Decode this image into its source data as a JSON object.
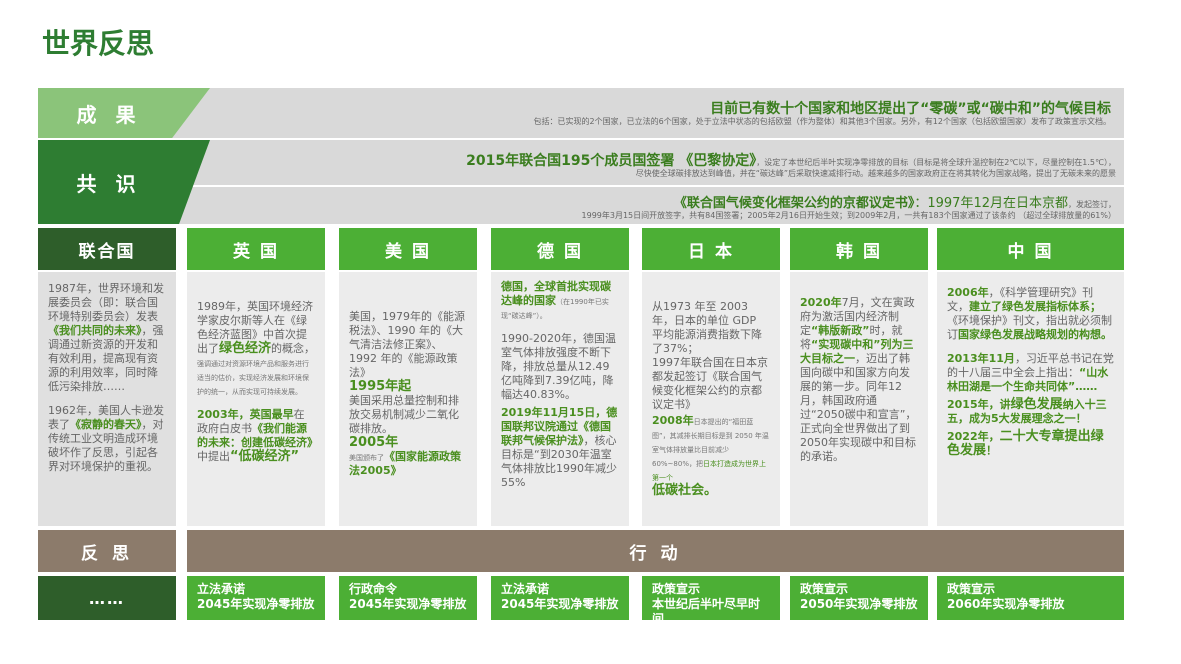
{
  "title": "世界反思",
  "rows": {
    "achievement": {
      "label": "成 果",
      "headline": "目前已有数十个国家和地区提出了“零碳”或“碳中和”的气候目标",
      "detail": "包括：已实现的2个国家，已立法的6个国家，处于立法中状态的包括欧盟（作为整体）和其他3个国家。另外，有12个国家（包括欧盟国家）发布了政策宣示文档。"
    },
    "consensus": {
      "label": "共 识",
      "paris_headline": "2015年联合国195个成员国签署 《巴黎协定》",
      "paris_detail_1": "，设定了本世纪后半叶实现净零排放的目标（目标是将全球升温控制在2℃以下，尽量控制在1.5℃），",
      "paris_detail_2": "尽快使全球碳排放达到峰值，并在“碳达峰”后采取快速减排行动。越来越多的国家政府正在将其转化为国家战略，提出了无碳未来的愿景",
      "kyoto_headline": "《联合国气候变化框架公约的京都议定书》",
      "kyoto_date": "：1997年12月在日本京都",
      "kyoto_tail": "，发起签订，",
      "kyoto_detail": "1999年3月15日间开放签字，共有84国签署；2005年2月16日开始生效；到2009年2月，一共有183个国家通过了该条约 （超过全球排放量的61%）"
    }
  },
  "columns": {
    "un": {
      "head": "联合国",
      "p1_a": "1987年，世界环境和发展委员会（即：联合国环境特别委员会）发表",
      "p1_b": "《我们共同的未来》",
      "p1_c": "，强调通过新资源的开发和有效利用，提高现有资源的利用效率，同时降低污染排放……",
      "p2_a": "1962年，美国人卡逊发表了",
      "p2_b": "《寂静的春天》",
      "p2_c": "，对传统工业文明造成环境破坏作了反思，引起各界对环境保护的重视。"
    },
    "uk": {
      "head": "英 国",
      "p1_a": "1989年，英国环境经济学家皮尔斯等人在《绿色经济蓝图》中首次提出了",
      "p1_b": "绿色经济",
      "p1_c": "的概念，",
      "p1_tiny": "强调通过对资源环境产品和服务进行适当的估价，实现经济发展和环境保护的统一，从而实现可持续发展。",
      "p2_a": "2003年，英国最早",
      "p2_b": "在政府白皮书",
      "p2_c": "《我们能源的未来：创建低碳经济》",
      "p2_d": "中提出",
      "p2_e": "“低碳经济”"
    },
    "us": {
      "head": "美 国",
      "p1": "美国，1979年的《能源税法》、1990 年的《大气清洁法修正案》、1992 年的《能源政策法》",
      "p2_a": "1995年起",
      "p2_b": "美国采用总量控制和排放交易机制减少二氧化碳排放。",
      "p3_a": "2005年",
      "p3_b": "美国颁布了",
      "p3_c": "《国家能源政策法2005》"
    },
    "de": {
      "head": "德 国",
      "p1_a": "德国，全球首批实现碳达峰的国家",
      "p1_b": "（在1990年已实现“碳达峰”）。",
      "p2": "1990-2020年，德国温室气体排放强度不断下降，排放总量从12.49亿吨降到7.39亿吨，降幅达40.83%。",
      "p3_a": "2019年11月15日，德国联邦议院通过《德国联邦气候保护法》",
      "p3_b": "，核心目标是“到2030年温室气体排放比1990年减少55%"
    },
    "jp": {
      "head": "日 本",
      "p1": "从1973 年至 2003 年，日本的单位 GDP 平均能源消费指数下降了37%；",
      "p2": "1997年联合国在日本京都发起签订《联合国气候变化框架公约的京都议定书》",
      "p3_a": "2008年",
      "p3_b": "日本提出的“福田蓝图”，其减排长期目标是到 2050 年温室气体排放量比目前减少 60%~80%，把",
      "p3_c": "日本打造成为世界上第一个",
      "p3_d": "低碳社会。"
    },
    "kr": {
      "head": "韩 国",
      "p1_a": "2020年",
      "p1_b": "7月，文在寅政府为激活国内经济制定",
      "p1_c": "“韩版新政”",
      "p1_d": "时，就将",
      "p1_e": "“实现碳中和”列为三大目标之一",
      "p1_f": "，迈出了韩国向碳中和国家方向发展的第一步。同年12月，韩国政府通过“2050碳中和宣言”，正式向全世界做出了到2050年实现碳中和目标的承诺。"
    },
    "cn": {
      "head": "中 国",
      "p1_a": "2006年",
      "p1_b": "，《科学管理研究》刊文，",
      "p1_c": "建立了绿色发展指标体系；",
      "p1_d": "《环境保护》刊文，指出就必须制订",
      "p1_e": "国家绿色发展战略规划的构想。",
      "p2_a": "2013年11月",
      "p2_b": "，习近平总书记在党的十八届三中全会上指出：",
      "p2_c": "“山水林田湖是一个生命共同体”……",
      "p3_a": "2015年，讲",
      "p3_b": "绿色发展",
      "p3_c": "纳入十三五，成为5大发展理念之一！",
      "p4_a": "2022年，",
      "p4_b": "二十大专章提出绿色发展",
      "p4_c": "！"
    }
  },
  "reflection_label": "反 思",
  "action_label": "行 动",
  "footer_left": "……",
  "footers": [
    {
      "l1": "立法承诺",
      "l2": "2045年实现净零排放"
    },
    {
      "l1": "行政命令",
      "l2": "2045年实现净零排放"
    },
    {
      "l1": "立法承诺",
      "l2": "2045年实现净零排放"
    },
    {
      "l1": "政策宣示",
      "l2": "本世纪后半叶尽早时间"
    },
    {
      "l1": "政策宣示",
      "l2": "2050年实现净零排放"
    },
    {
      "l1": "政策宣示",
      "l2": "2060年实现净零排放"
    }
  ]
}
